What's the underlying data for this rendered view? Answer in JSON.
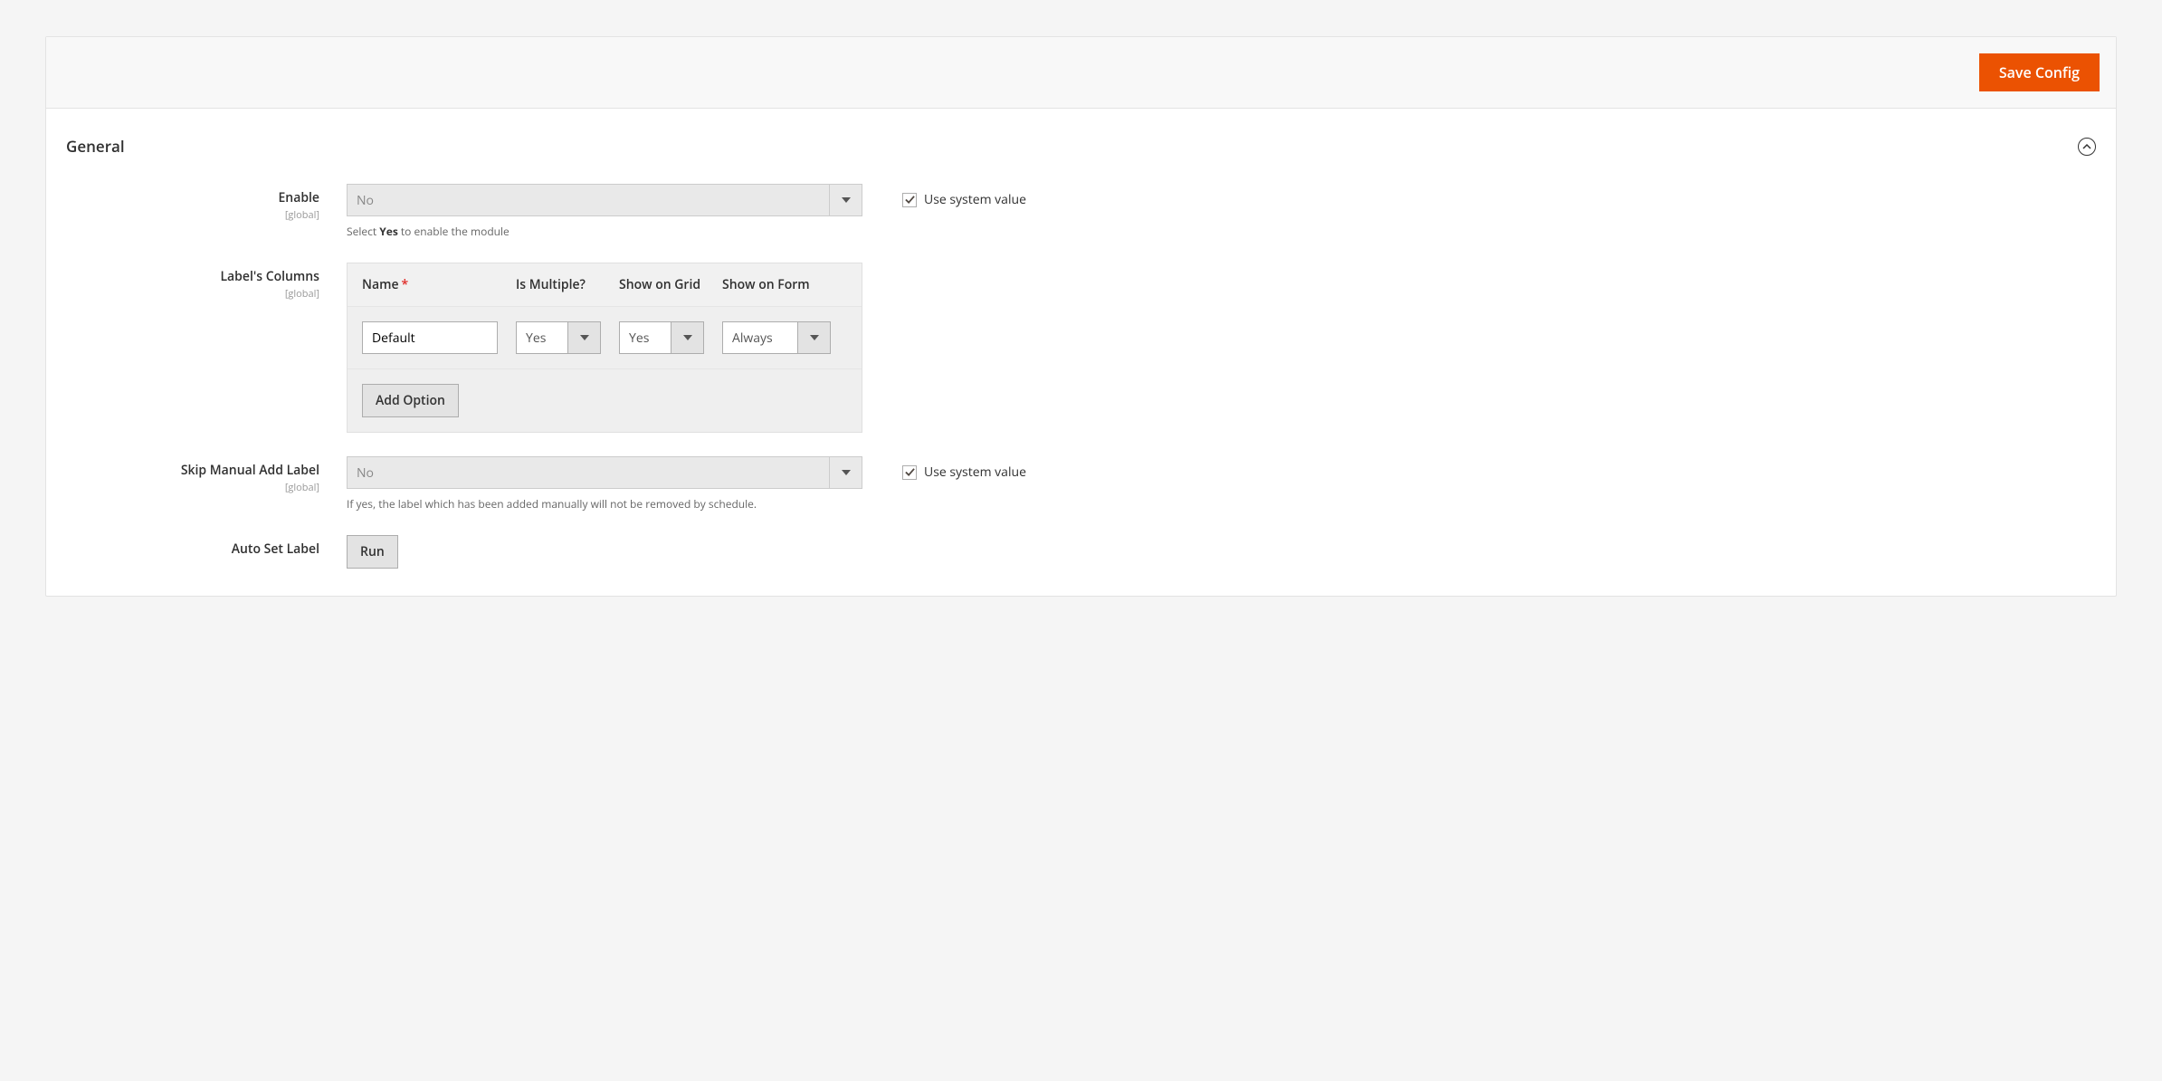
{
  "header": {
    "save_button": "Save Config"
  },
  "section": {
    "title": "General"
  },
  "fields": {
    "enable": {
      "label": "Enable",
      "scope": "[global]",
      "value": "No",
      "note_prefix": "Select ",
      "note_bold": "Yes",
      "note_suffix": " to enable the module",
      "use_system_label": "Use system value",
      "use_system_checked": true
    },
    "labels_columns": {
      "label": "Label's Columns",
      "scope": "[global]",
      "headers": {
        "name": "Name",
        "is_multiple": "Is Multiple?",
        "show_on_grid": "Show on Grid",
        "show_on_form": "Show on Form"
      },
      "row": {
        "name": "Default",
        "is_multiple": "Yes",
        "show_on_grid": "Yes",
        "show_on_form": "Always"
      },
      "add_option": "Add Option"
    },
    "skip_manual": {
      "label": "Skip Manual Add Label",
      "scope": "[global]",
      "value": "No",
      "note": "If yes, the label which has been added manually will not be removed by schedule.",
      "use_system_label": "Use system value",
      "use_system_checked": true
    },
    "auto_set": {
      "label": "Auto Set Label",
      "button": "Run"
    }
  }
}
